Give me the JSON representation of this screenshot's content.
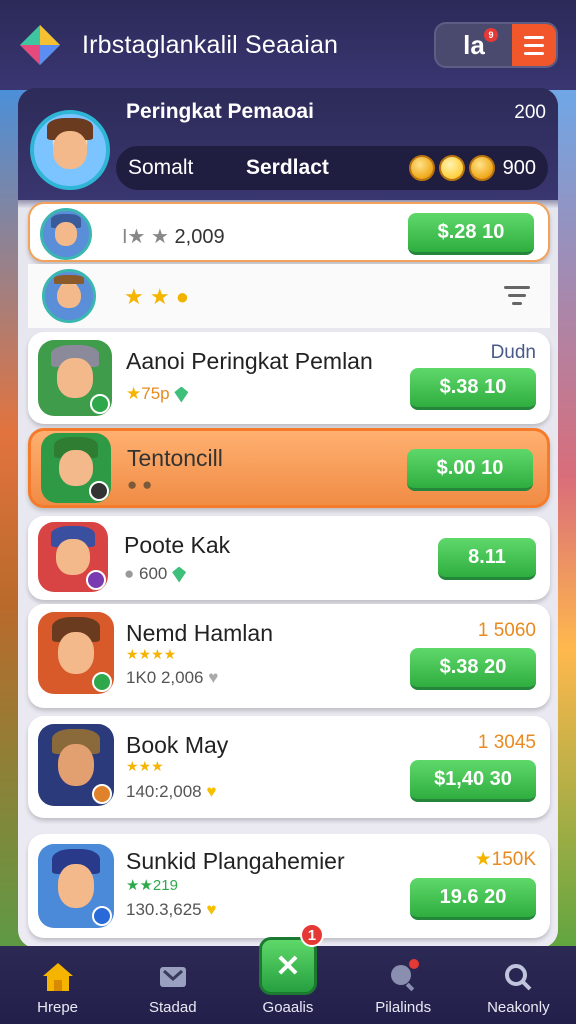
{
  "topbar": {
    "title": "Irbstaglankalil Seaaian",
    "action_label": "la",
    "action_badge": "9"
  },
  "header": {
    "title": "Peringkat Pemaoai",
    "count": "200",
    "tab1": "Somalt",
    "tab2": "Serdlact",
    "coin_value": "900"
  },
  "rows": [
    {
      "name": "",
      "sub": "2,009",
      "right": "",
      "price": "$.28 10"
    },
    {
      "name": "",
      "sub": "",
      "right": "",
      "price": ""
    },
    {
      "name": "Aanoi Peringkat Pemlan",
      "sub": "75p",
      "right": "Dudn",
      "price": "$.38 10"
    },
    {
      "name": "Tentoncill",
      "sub": "",
      "right": "",
      "price": "$.00 10",
      "avatar_label": "Tentoncill"
    },
    {
      "name": "Poote Kak",
      "sub": "600",
      "right": "",
      "price": "8.11"
    },
    {
      "name": "Nemd Hamlan",
      "sub": "1K0 2,006",
      "right": "1 5060",
      "price": "$.38 20"
    },
    {
      "name": "Book May",
      "sub": "140:2,008",
      "right": "1 3045",
      "price": "$1,40 30"
    },
    {
      "name": "Sunkid Plangahemier",
      "sub": "130.3,625",
      "right": "150K",
      "price": "19.6 20",
      "stars": "219"
    }
  ],
  "nav": {
    "items": [
      {
        "label": "Hrepe",
        "icon": "home-icon"
      },
      {
        "label": "Stadad",
        "icon": "trophy-icon"
      },
      {
        "label": "Goaalis",
        "icon": "goals-icon",
        "badge": "1"
      },
      {
        "label": "Pilalinds",
        "icon": "search-icon"
      },
      {
        "label": "Neakonly",
        "icon": "magnifier-icon"
      }
    ]
  },
  "colors": {
    "accent_green": "#2fae3f",
    "highlight_orange": "#f08c45",
    "topbar_bg": "#2b2a58",
    "menu_orange": "#f2572b"
  }
}
